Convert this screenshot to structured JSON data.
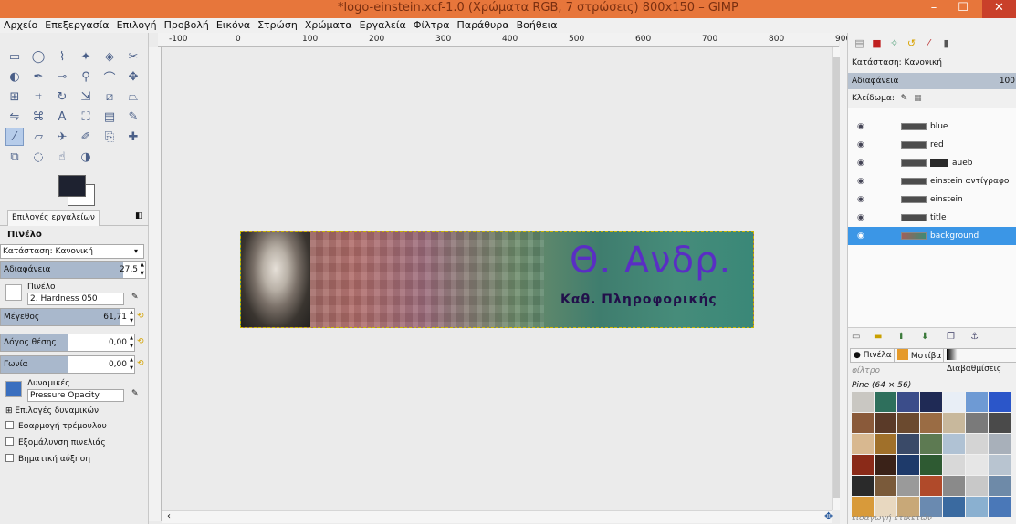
{
  "window": {
    "title": "*logo-einstein.xcf-1.0 (Χρώματα RGB, 7 στρώσεις) 800x150 – GIMP",
    "controls": [
      "–",
      "☐",
      "✕"
    ]
  },
  "menu": [
    "Αρχείο",
    "Επεξεργασία",
    "Επιλογή",
    "Προβολή",
    "Εικόνα",
    "Στρώση",
    "Χρώματα",
    "Εργαλεία",
    "Φίλτρα",
    "Παράθυρα",
    "Βοήθεια"
  ],
  "toolbox": {
    "tools": [
      "rect-select",
      "ellipse-select",
      "free-select",
      "fuzzy-select",
      "select-by-color",
      "scissors",
      "foreground-select",
      "paths",
      "color-picker",
      "zoom",
      "measure",
      "move",
      "align",
      "crop",
      "rotate",
      "scale",
      "shear",
      "perspective",
      "flip",
      "cage",
      "text",
      "bucket-fill",
      "blend",
      "pencil",
      "paintbrush",
      "eraser",
      "airbrush",
      "ink",
      "clone",
      "heal",
      "perspective-clone",
      "blur",
      "smudge",
      "dodge-burn"
    ],
    "active_tool": "paintbrush",
    "fg_color": "#1e2230",
    "bg_color": "#ffffff"
  },
  "tool_options": {
    "tab_label": "Επιλογές εργαλείων",
    "title": "Πινέλο",
    "mode_label": "Κατάσταση: Κανονική",
    "opacity": {
      "label": "Αδιαφάνεια",
      "value": "27,5",
      "fraction": 0.85
    },
    "brush": {
      "caption": "Πινέλο",
      "name": "2. Hardness 050"
    },
    "size": {
      "label": "Μέγεθος",
      "value": "61,71",
      "fraction": 0.9
    },
    "aspect": {
      "label": "Λόγος θέσης",
      "value": "0,00",
      "fraction": 0.5
    },
    "angle": {
      "label": "Γωνία",
      "value": "0,00",
      "fraction": 0.5
    },
    "dynamics": {
      "caption": "Δυναμικές",
      "name": "Pressure Opacity"
    },
    "dynamics_options": "Επιλογές δυναμικών",
    "checks": [
      "Εφαρμογή τρέμουλου",
      "Εξομάλυνση πινελιάς",
      "Βηματική αύξηση"
    ]
  },
  "canvas": {
    "ruler_labels": [
      "-100",
      "0",
      "100",
      "200",
      "300",
      "400",
      "500",
      "600",
      "700",
      "800",
      "900"
    ],
    "logo_title": "Θ. Ανδρ.",
    "logo_subtitle": "Καθ. Πληροφορικής"
  },
  "layers_panel": {
    "mode": "Κατάσταση: Κανονική",
    "opacity_label": "Αδιαφάνεια",
    "opacity_value": "100",
    "lock_label": "Κλείδωμα:",
    "layers": [
      {
        "name": "blue",
        "selected": false
      },
      {
        "name": "red",
        "selected": false
      },
      {
        "name": "aueb",
        "selected": false
      },
      {
        "name": "einstein αντίγραφο",
        "selected": false
      },
      {
        "name": "einstein",
        "selected": false
      },
      {
        "name": "title",
        "selected": false
      },
      {
        "name": "background",
        "selected": true
      }
    ]
  },
  "brushes_panel": {
    "tabs": [
      "Πινέλα",
      "Μοτίβα",
      "Διαβαθμίσεις"
    ],
    "filter_placeholder": "φίλτρο",
    "pattern_info": "Pine (64 × 56)",
    "tag_entry": "εισαγωγή ετικετών"
  }
}
